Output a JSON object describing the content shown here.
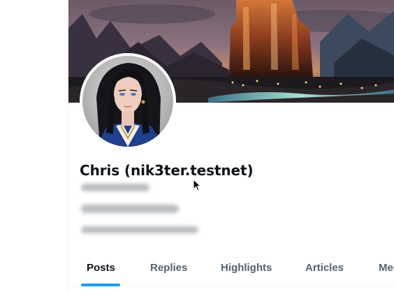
{
  "profile": {
    "display_name": "Chris (nik3ter.testnet)",
    "handle_blurred": true,
    "bio_blurred": true,
    "meta_blurred": true
  },
  "tabs": [
    {
      "label": "Posts",
      "active": true
    },
    {
      "label": "Replies",
      "active": false
    },
    {
      "label": "Highlights",
      "active": false
    },
    {
      "label": "Articles",
      "active": false
    },
    {
      "label": "Media",
      "active": false
    }
  ],
  "colors": {
    "accent": "#1d9bf0",
    "text_primary": "#0f1419",
    "text_secondary": "#536471",
    "border": "#eff3f4"
  },
  "icons": {
    "cursor": "mouse-pointer-icon"
  }
}
